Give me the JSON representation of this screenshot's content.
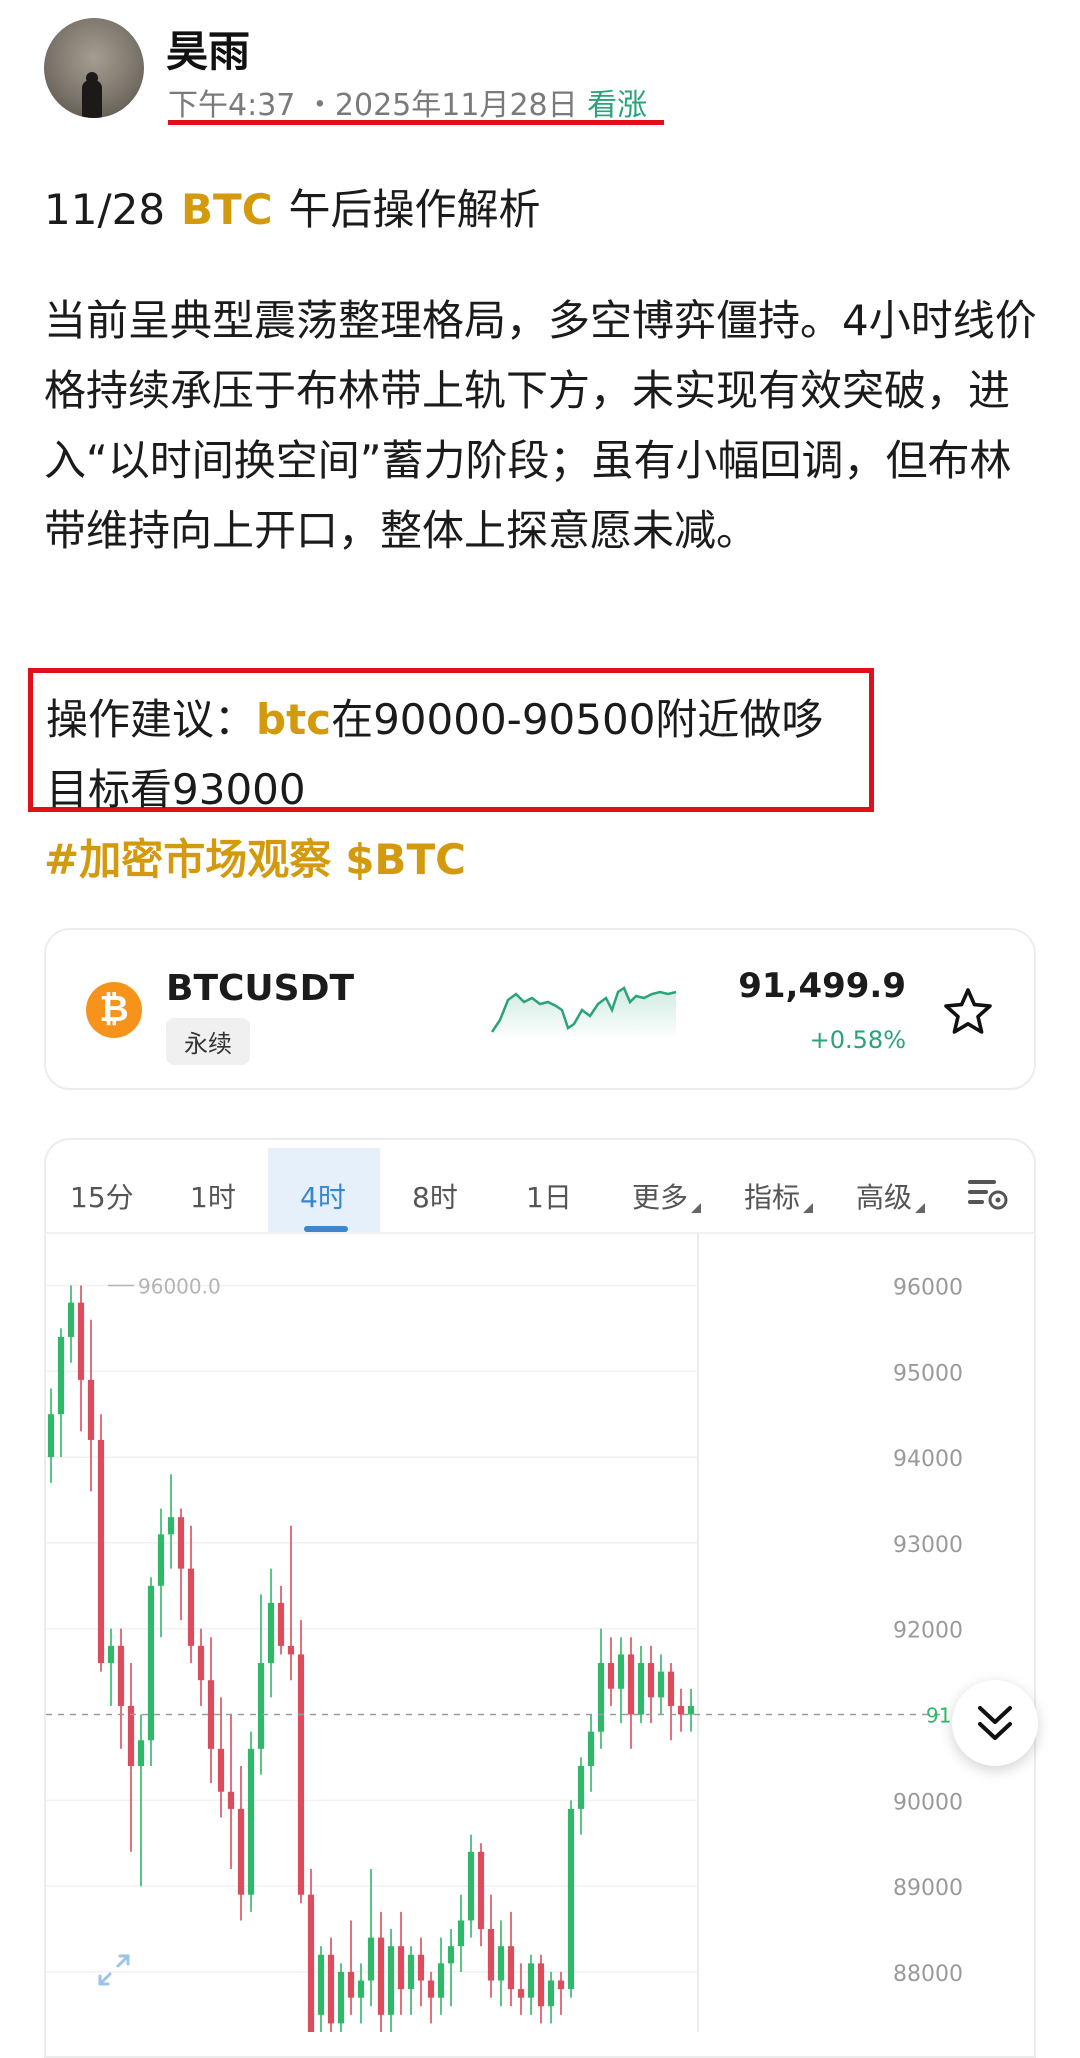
{
  "post": {
    "author": "昊雨",
    "time": "下午4:37",
    "date": "・2025年11月28日",
    "sentiment": "看涨",
    "title_date": "11/28",
    "title_coin": "BTC",
    "title_text": "午后操作解析",
    "paragraph": "当前呈典型震荡整理格局，多空博弈僵持。4小时线价格持续承压于布林带上轨下方，未实现有效突破，进入“以时间换空间”蓄力阶段；虽有小幅回调，但布林带维持向上开口，整体上探意愿未减。",
    "advice_prefix": "操作建议：",
    "advice_coin": "btc",
    "advice_text": "在90000-90500附近做哆",
    "advice_target": "目标看93000",
    "hashtag": "#加密市场观察",
    "cashtag": "$BTC"
  },
  "ticker": {
    "symbol": "BTCUSDT",
    "type": "永续",
    "price": "91,499.9",
    "change": "+0.58%",
    "logo_icon": "bitcoin-logo-icon",
    "fav_icon": "star-outline-icon",
    "accent_up": "#2aa37a"
  },
  "chart": {
    "tabs": [
      "15分",
      "1时",
      "4时",
      "8时",
      "1日"
    ],
    "active_tab": "4时",
    "more_label": "更多",
    "indicator_label": "指标",
    "advanced_label": "高级",
    "settings_icon": "chart-settings-icon",
    "scroll_icon": "double-chevron-down-icon",
    "expand_icon": "expand-arrows-icon",
    "up_color": "#2fb869",
    "down_color": "#dc4c5c"
  },
  "chart_data": {
    "type": "candlestick",
    "interval": "4时",
    "y_ticks": [
      96000,
      95000,
      94000,
      93000,
      92000,
      90000,
      89000,
      88000
    ],
    "ylim": [
      87300,
      96600
    ],
    "high_label": "96000.0",
    "last_price": 91000,
    "last_label": "91(",
    "grid": true,
    "ohlc": [
      [
        94000,
        94800,
        93700,
        94500
      ],
      [
        94500,
        95500,
        94000,
        95400
      ],
      [
        95400,
        96000,
        95100,
        95800
      ],
      [
        95800,
        96000,
        94300,
        94900
      ],
      [
        94900,
        95600,
        93600,
        94200
      ],
      [
        94200,
        94500,
        91500,
        91600
      ],
      [
        91600,
        92000,
        91100,
        91800
      ],
      [
        91800,
        92000,
        90600,
        91100
      ],
      [
        91100,
        91600,
        89400,
        90400
      ],
      [
        90400,
        91000,
        89000,
        90700
      ],
      [
        90700,
        92600,
        90400,
        92500
      ],
      [
        92500,
        93400,
        91900,
        93100
      ],
      [
        93100,
        93800,
        92700,
        93300
      ],
      [
        93300,
        93400,
        92100,
        92700
      ],
      [
        92700,
        93200,
        91600,
        91800
      ],
      [
        91800,
        92000,
        91100,
        91400
      ],
      [
        91400,
        91900,
        90200,
        90600
      ],
      [
        90600,
        91200,
        89800,
        90100
      ],
      [
        90100,
        91000,
        89200,
        89900
      ],
      [
        89900,
        90400,
        88600,
        88900
      ],
      [
        88900,
        90800,
        88700,
        90600
      ],
      [
        90600,
        92400,
        90300,
        91600
      ],
      [
        91600,
        92700,
        91200,
        92300
      ],
      [
        92300,
        92500,
        91700,
        91800
      ],
      [
        91800,
        93200,
        91400,
        91700
      ],
      [
        91700,
        92100,
        88800,
        88900
      ],
      [
        88900,
        89200,
        86900,
        87300
      ],
      [
        87500,
        88300,
        87100,
        88200
      ],
      [
        88200,
        88400,
        87200,
        87400
      ],
      [
        87400,
        88100,
        87100,
        88000
      ],
      [
        88000,
        88600,
        87500,
        87700
      ],
      [
        87700,
        88100,
        87400,
        87900
      ],
      [
        87900,
        89200,
        87600,
        88400
      ],
      [
        88400,
        88700,
        87200,
        87500
      ],
      [
        87500,
        88500,
        87200,
        88300
      ],
      [
        88300,
        88700,
        87500,
        87800
      ],
      [
        87800,
        88300,
        87500,
        88200
      ],
      [
        88200,
        88400,
        87600,
        87900
      ],
      [
        87900,
        88000,
        87400,
        87700
      ],
      [
        87700,
        88400,
        87500,
        88100
      ],
      [
        88100,
        88500,
        87600,
        88300
      ],
      [
        88300,
        88900,
        88000,
        88600
      ],
      [
        88600,
        89600,
        88400,
        89400
      ],
      [
        89400,
        89500,
        88300,
        88500
      ],
      [
        88500,
        88900,
        87700,
        87900
      ],
      [
        87900,
        88600,
        87600,
        88300
      ],
      [
        88300,
        88700,
        87600,
        87800
      ],
      [
        87800,
        88100,
        87500,
        87700
      ],
      [
        87700,
        88200,
        87500,
        88100
      ],
      [
        88100,
        88200,
        87400,
        87600
      ],
      [
        87600,
        88000,
        87400,
        87900
      ],
      [
        87900,
        88000,
        87500,
        87800
      ],
      [
        87800,
        90000,
        87700,
        89900
      ],
      [
        89900,
        90500,
        89600,
        90400
      ],
      [
        90400,
        91000,
        90100,
        90800
      ],
      [
        90800,
        92000,
        90600,
        91600
      ],
      [
        91600,
        91900,
        91100,
        91300
      ],
      [
        91300,
        91900,
        90900,
        91700
      ],
      [
        91700,
        91900,
        90600,
        91000
      ],
      [
        91000,
        91800,
        90900,
        91600
      ],
      [
        91600,
        91800,
        90900,
        91200
      ],
      [
        91200,
        91700,
        91000,
        91500
      ],
      [
        91500,
        91600,
        90700,
        91100
      ],
      [
        91100,
        91300,
        90800,
        91000
      ],
      [
        91000,
        91300,
        90800,
        91100
      ]
    ]
  }
}
